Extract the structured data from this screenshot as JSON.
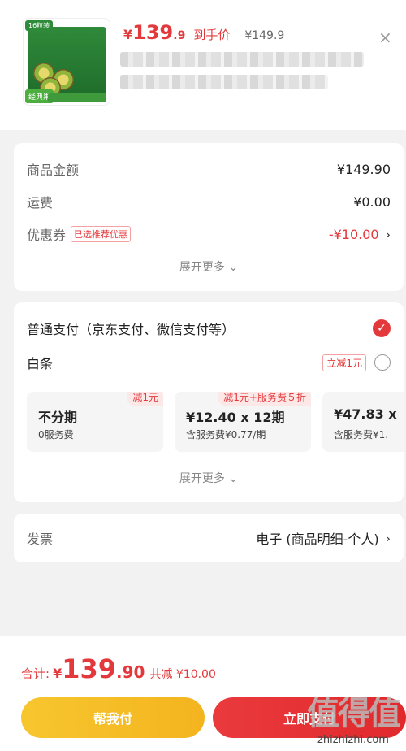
{
  "product": {
    "thumb_tag": "16粒装",
    "thumb_badge": "经典果",
    "currency": "¥",
    "price_int": "139",
    "price_dec": ".9",
    "price_label": "到手价",
    "original_price": "¥149.9",
    "close_symbol": "×"
  },
  "summary": {
    "goods_label": "商品金额",
    "goods_value": "¥149.90",
    "shipping_label": "运费",
    "shipping_value": "¥0.00",
    "coupon_label": "优惠券",
    "coupon_chip": "已选推荐优惠",
    "coupon_value": "-¥10.00",
    "more_label": "展开更多 ⌄"
  },
  "payment": {
    "normal_label": "普通支付（京东支付、微信支付等）",
    "baitiao_label": "白条",
    "baitiao_chip": "立减1元",
    "plans": [
      {
        "title": "不分期",
        "sub": "0服务费",
        "ribbon": "减1元"
      },
      {
        "title": "¥12.40 x 12期",
        "sub": "含服务费¥0.77/期",
        "ribbon": "减1元+服务费５折"
      },
      {
        "title": "¥47.83 x",
        "sub": "含服务费¥1."
      }
    ],
    "more_label": "展开更多 ⌄"
  },
  "invoice": {
    "label": "发票",
    "value": "电子 (商品明细-个人)"
  },
  "footer": {
    "total_label": "合计:",
    "currency": "¥",
    "total_int": "139",
    "total_dec": ".90",
    "saved": "共减 ¥10.00",
    "help_button": "帮我付",
    "pay_button": "立即支付",
    "watermark_big": "值得值",
    "watermark_small": "zhizhizhi.com"
  },
  "colors": {
    "accent_red": "#e4393c",
    "accent_yellow": "#f4b41f"
  }
}
